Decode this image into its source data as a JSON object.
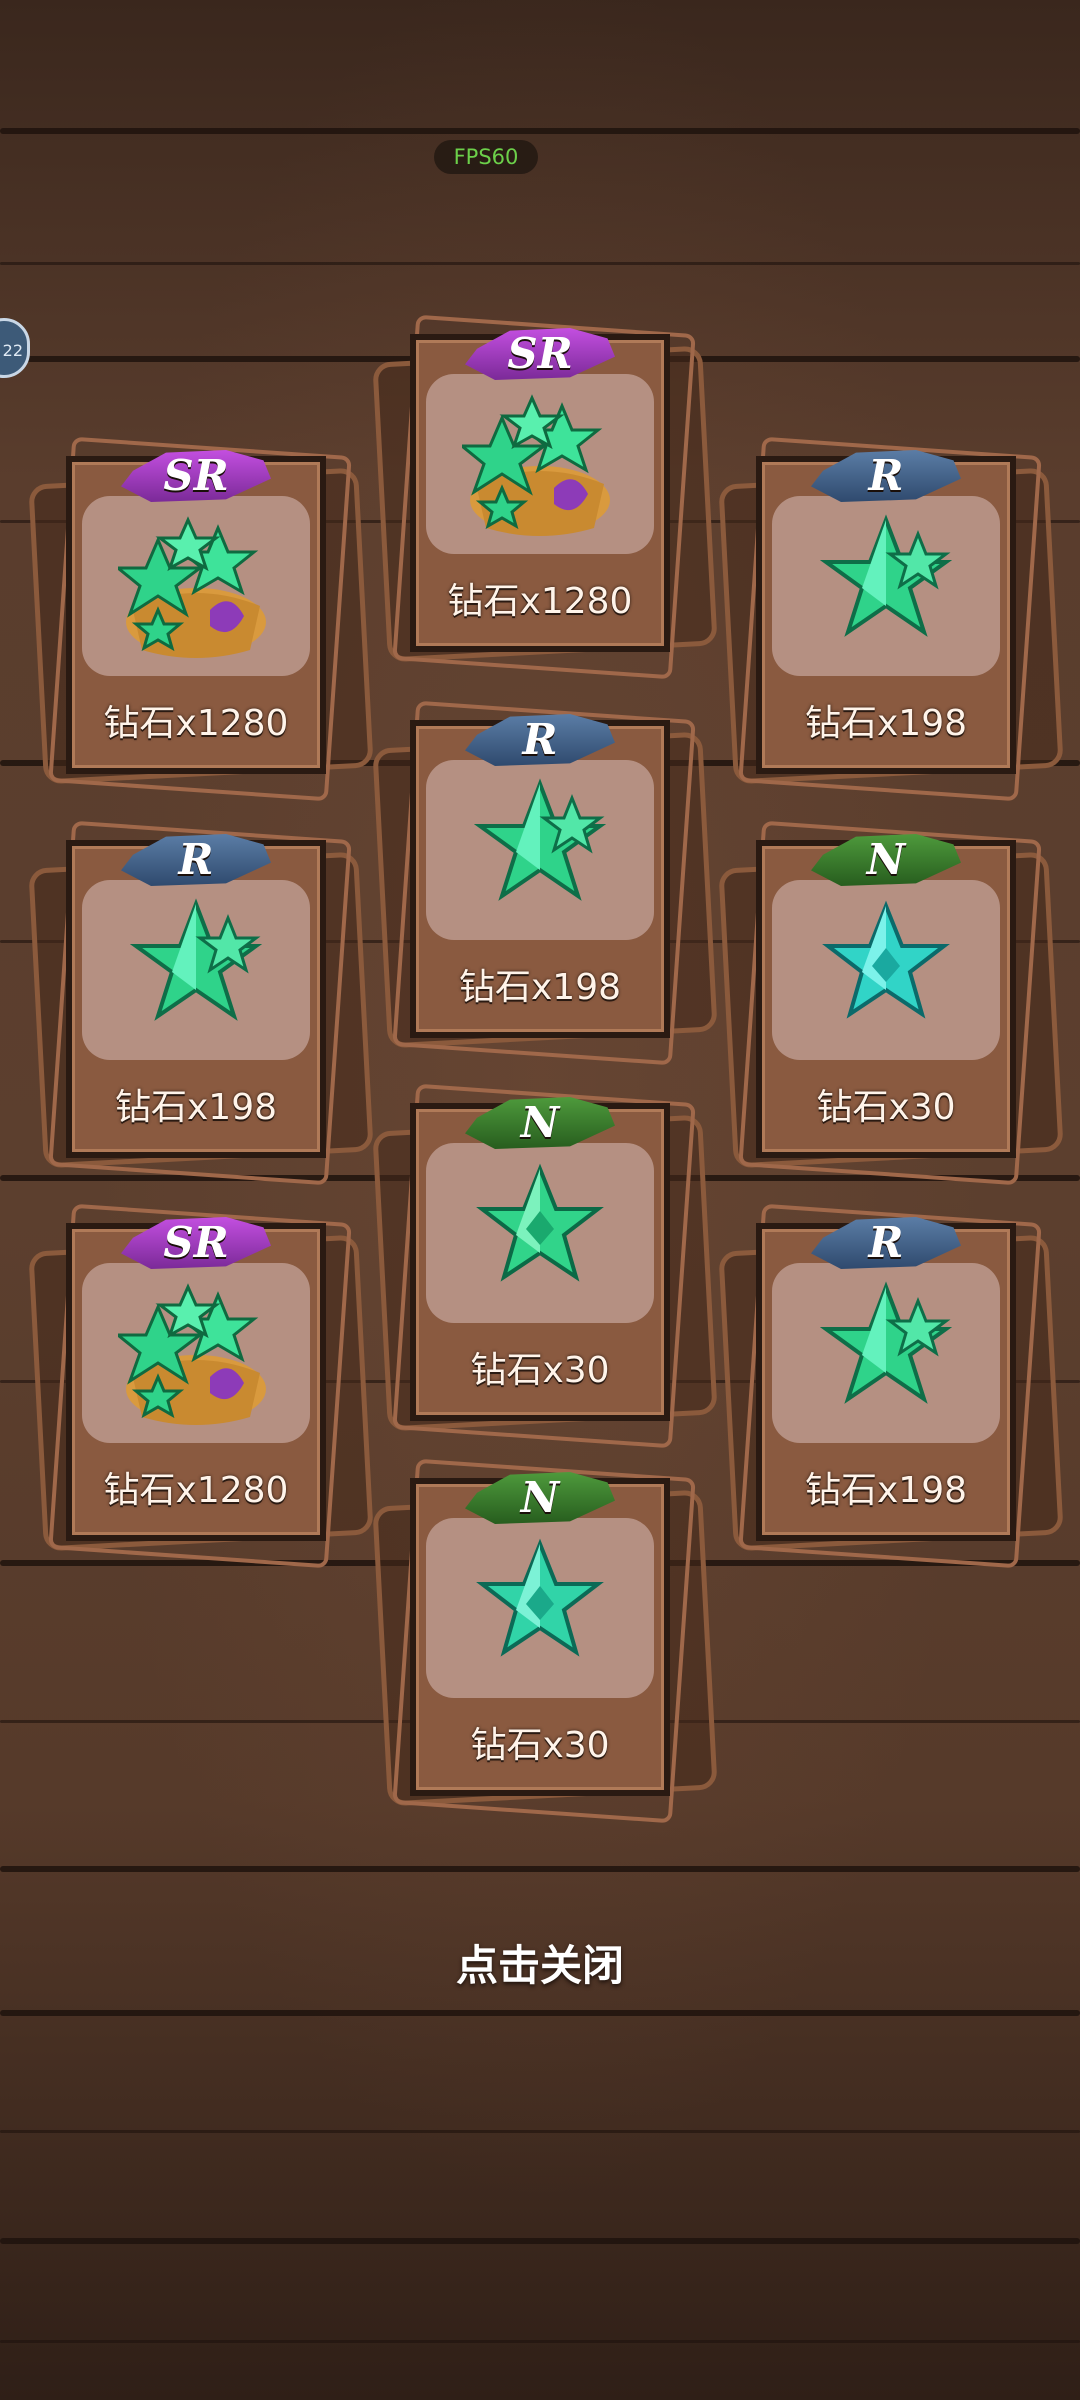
{
  "hud": {
    "fps_label": "FPS60",
    "side_button_label": "22"
  },
  "rewards": [
    {
      "rarity": "SR",
      "item": "钻石x1280",
      "icon": "diamond-bag-icon"
    },
    {
      "rarity": "SR",
      "item": "钻石x1280",
      "icon": "diamond-bag-icon"
    },
    {
      "rarity": "R",
      "item": "钻石x198",
      "icon": "diamond-cluster-icon"
    },
    {
      "rarity": "R",
      "item": "钻石x198",
      "icon": "diamond-cluster-icon"
    },
    {
      "rarity": "R",
      "item": "钻石x198",
      "icon": "diamond-cluster-icon"
    },
    {
      "rarity": "N",
      "item": "钻石x30",
      "icon": "diamond-star-icon"
    },
    {
      "rarity": "SR",
      "item": "钻石x1280",
      "icon": "diamond-bag-icon"
    },
    {
      "rarity": "N",
      "item": "钻石x30",
      "icon": "diamond-star-icon"
    },
    {
      "rarity": "R",
      "item": "钻石x198",
      "icon": "diamond-cluster-icon"
    },
    {
      "rarity": "N",
      "item": "钻石x30",
      "icon": "diamond-star-icon"
    }
  ],
  "footer": {
    "close_hint": "点击关闭"
  },
  "colors": {
    "sr": "#b043d0",
    "r": "#4a6c94",
    "n": "#3e8a30",
    "gem": "#2fd38a",
    "frame": "#8a5a40"
  }
}
